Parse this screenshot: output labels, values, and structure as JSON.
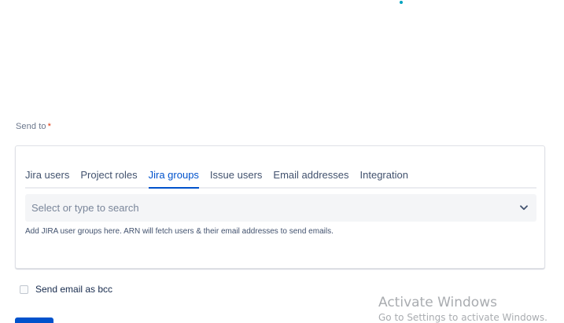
{
  "form": {
    "send_to_label": "Send to",
    "required_marker": "*"
  },
  "recipients": {
    "tabs": [
      {
        "label": "Jira users",
        "active": false
      },
      {
        "label": "Project roles",
        "active": false
      },
      {
        "label": "Jira groups",
        "active": true
      },
      {
        "label": "Issue users",
        "active": false
      },
      {
        "label": "Email addresses",
        "active": false
      },
      {
        "label": "Integration",
        "active": false
      }
    ],
    "search": {
      "placeholder": "Select or type to search",
      "icon": "chevron-down-icon"
    },
    "helper_text": "Add JIRA user groups here. ARN will fetch users & their email addresses to send emails."
  },
  "bcc": {
    "label": "Send email as bcc",
    "checked": false
  },
  "watermark": {
    "title": "Activate Windows",
    "subtitle": "Go to Settings to activate Windows."
  },
  "colors": {
    "accent": "#0052cc",
    "required": "#de350b",
    "dot": "#00a3bf"
  }
}
